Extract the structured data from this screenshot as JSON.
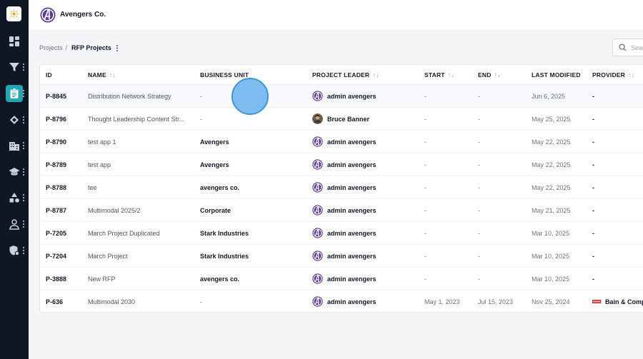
{
  "app": {
    "company_name": "Avengers Co."
  },
  "colors": {
    "sidebar_bg": "#0f1724",
    "accent": "#21a6b3",
    "avatar_purple": "#5b3a8e"
  },
  "sidebar": {
    "items": [
      {
        "name": "dashboard-icon",
        "active": false
      },
      {
        "name": "filter-icon",
        "active": false
      },
      {
        "name": "clipboard-icon",
        "active": true
      },
      {
        "name": "handshake-icon",
        "active": false
      },
      {
        "name": "building-icon",
        "active": false
      },
      {
        "name": "graduation-cap-icon",
        "active": false
      },
      {
        "name": "shapes-icon",
        "active": false
      },
      {
        "name": "user-icon",
        "active": false
      },
      {
        "name": "shield-icon",
        "active": false
      }
    ]
  },
  "breadcrumb": {
    "parent": "Projects",
    "separator": "/",
    "current": "RFP Projects"
  },
  "search": {
    "placeholder": "Search"
  },
  "table": {
    "columns": [
      "ID",
      "NAME",
      "BUSINESS UNIT",
      "PROJECT LEADER",
      "START",
      "END",
      "LAST MODIFIED",
      "PROVIDER"
    ],
    "rows": [
      {
        "id": "P-8845",
        "name": "Distribution Network Strategy",
        "business_unit": "-",
        "leader": "admin avengers",
        "start": "-",
        "end": "-",
        "last_modified": "Jun 6, 2025",
        "provider": "-"
      },
      {
        "id": "P-8796",
        "name": "Thought Leadership Content Str...",
        "business_unit": "-",
        "leader": "Bruce Banner",
        "start": "-",
        "end": "-",
        "last_modified": "May 25, 2025",
        "provider": "-"
      },
      {
        "id": "P-8790",
        "name": "test app 1",
        "business_unit": "Avengers",
        "leader": "admin avengers",
        "start": "-",
        "end": "-",
        "last_modified": "May 22, 2025",
        "provider": "-"
      },
      {
        "id": "P-8789",
        "name": "test app",
        "business_unit": "Avengers",
        "leader": "admin avengers",
        "start": "-",
        "end": "-",
        "last_modified": "May 22, 2025",
        "provider": "-"
      },
      {
        "id": "P-8788",
        "name": "tee",
        "business_unit": "avengers co.",
        "leader": "admin avengers",
        "start": "-",
        "end": "-",
        "last_modified": "May 22, 2025",
        "provider": "-"
      },
      {
        "id": "P-8787",
        "name": "Multimodal 2025/2",
        "business_unit": "Corporate",
        "leader": "admin avengers",
        "start": "-",
        "end": "-",
        "last_modified": "May 21, 2025",
        "provider": "-"
      },
      {
        "id": "P-7205",
        "name": "March Project Duplicated",
        "business_unit": "Stark Industries",
        "leader": "admin avengers",
        "start": "-",
        "end": "-",
        "last_modified": "Mar 10, 2025",
        "provider": "-"
      },
      {
        "id": "P-7204",
        "name": "March Project",
        "business_unit": "Stark Industries",
        "leader": "admin avengers",
        "start": "-",
        "end": "-",
        "last_modified": "Mar 10, 2025",
        "provider": "-"
      },
      {
        "id": "P-3888",
        "name": "New RFP",
        "business_unit": "avengers co.",
        "leader": "admin avengers",
        "start": "-",
        "end": "-",
        "last_modified": "Mar 10, 2025",
        "provider": "-"
      },
      {
        "id": "P-636",
        "name": "Multimodal 2030",
        "business_unit": "-",
        "leader": "admin avengers",
        "start": "May 1, 2023",
        "end": "Jul 15, 2023",
        "last_modified": "Nov 25, 2024",
        "provider": "Bain & Comp"
      }
    ]
  }
}
